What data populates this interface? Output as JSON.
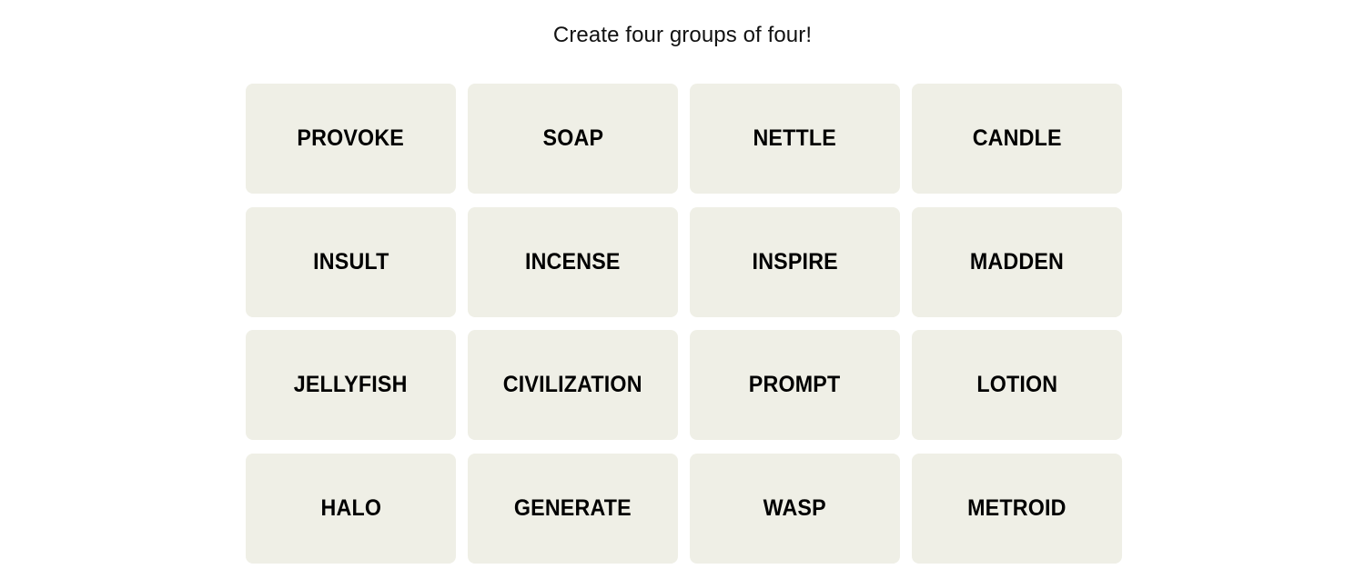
{
  "game": {
    "instruction": "Create four groups of four!"
  },
  "colors": {
    "page_background": "#FFFFFF",
    "tile_background": "#EFEFE6",
    "tile_text": "#000000",
    "instruction_text": "#121212"
  },
  "board": {
    "columns": 4,
    "rows": 4,
    "tiles": [
      {
        "label": "PROVOKE"
      },
      {
        "label": "SOAP"
      },
      {
        "label": "NETTLE"
      },
      {
        "label": "CANDLE"
      },
      {
        "label": "INSULT"
      },
      {
        "label": "INCENSE"
      },
      {
        "label": "INSPIRE"
      },
      {
        "label": "MADDEN"
      },
      {
        "label": "JELLYFISH"
      },
      {
        "label": "CIVILIZATION"
      },
      {
        "label": "PROMPT"
      },
      {
        "label": "LOTION"
      },
      {
        "label": "HALO"
      },
      {
        "label": "GENERATE"
      },
      {
        "label": "WASP"
      },
      {
        "label": "METROID"
      }
    ]
  }
}
